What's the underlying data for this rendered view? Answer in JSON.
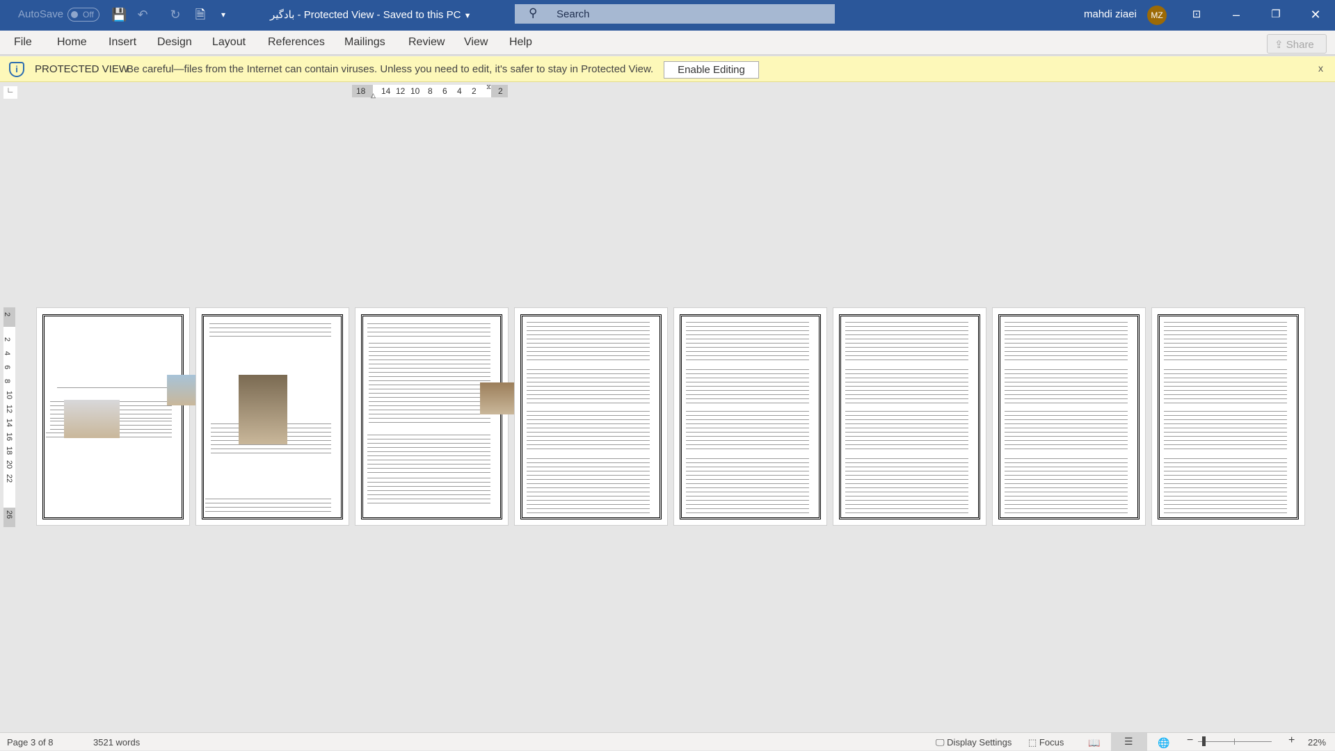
{
  "titlebar": {
    "autosave_label": "AutoSave",
    "autosave_state": "Off",
    "doc_title": "بادگیر",
    "separator": "-",
    "mode": "Protected View",
    "save_state": "Saved to this PC",
    "search_placeholder": "Search",
    "user_name": "mahdi ziaei",
    "avatar_initials": "MZ",
    "avatar_color": "#9c6a06",
    "bar_color": "#2b579a"
  },
  "ribbon": {
    "tabs": [
      "File",
      "Home",
      "Insert",
      "Design",
      "Layout",
      "References",
      "Mailings",
      "Review",
      "View",
      "Help"
    ],
    "share_label": "Share"
  },
  "protected_view": {
    "label": "PROTECTED VIEW",
    "message": "Be careful—files from the Internet can contain viruses. Unless you need to edit, it's safer to stay in Protected View.",
    "enable_button": "Enable Editing",
    "close": "x",
    "bg_color": "#fdf8b9"
  },
  "ruler": {
    "horizontal": [
      "18",
      "14",
      "12",
      "10",
      "8",
      "6",
      "4",
      "2",
      "2"
    ],
    "vertical": [
      "2",
      "2",
      "4",
      "6",
      "8",
      "10",
      "12",
      "14",
      "16",
      "18",
      "20",
      "22",
      "26"
    ]
  },
  "document": {
    "page_count": 8
  },
  "status": {
    "page": "Page 3 of 8",
    "words": "3521 words",
    "display_settings": "Display Settings",
    "focus": "Focus",
    "zoom": "22%",
    "zoom_level": 22
  }
}
